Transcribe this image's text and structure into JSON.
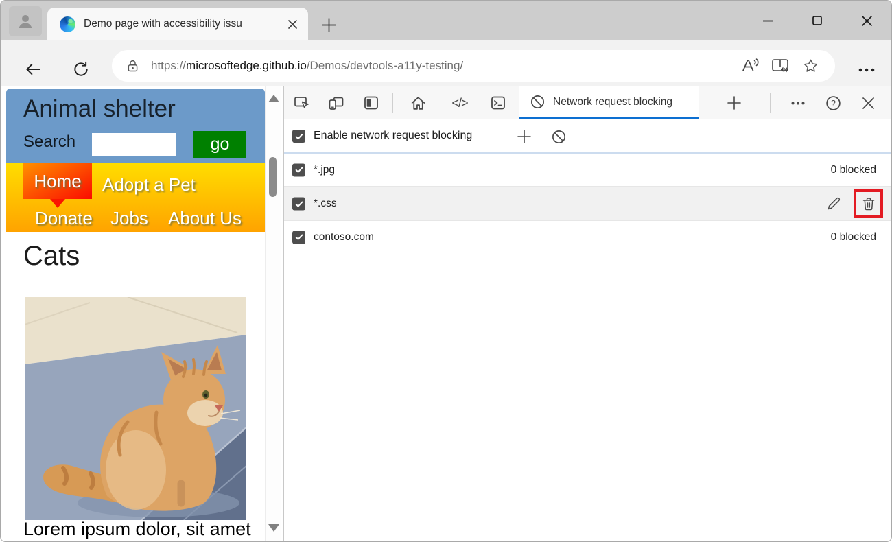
{
  "tab_bar": {
    "tab_title": "Demo page with accessibility issu"
  },
  "address_bar": {
    "scheme": "https://",
    "domain": "microsoftedge.github.io",
    "path": "/Demos/devtools-a11y-testing/"
  },
  "page": {
    "title": "Animal shelter",
    "search_label": "Search",
    "search_value": "",
    "go_button": "go",
    "nav": [
      "Home",
      "Adopt a Pet",
      "Donate",
      "Jobs",
      "About Us"
    ],
    "section_heading": "Cats",
    "body_text": "Lorem ipsum dolor, sit amet"
  },
  "devtools": {
    "tab_label": "Network request blocking",
    "enable_label": "Enable network request blocking",
    "code_glyph": "</>",
    "rows": [
      {
        "pattern": "*.jpg",
        "status": "0 blocked",
        "checked": true
      },
      {
        "pattern": "*.css",
        "status": "",
        "checked": true
      },
      {
        "pattern": "contoso.com",
        "status": "0 blocked",
        "checked": true
      }
    ]
  },
  "colors": {
    "accent_blue": "#0d6fd1",
    "highlight_red": "#e31b23",
    "header_blue": "#6c9ac9",
    "nav_gradient_top": "#ffdd00",
    "nav_gradient_bottom": "#ffa300",
    "go_green": "#008000"
  }
}
